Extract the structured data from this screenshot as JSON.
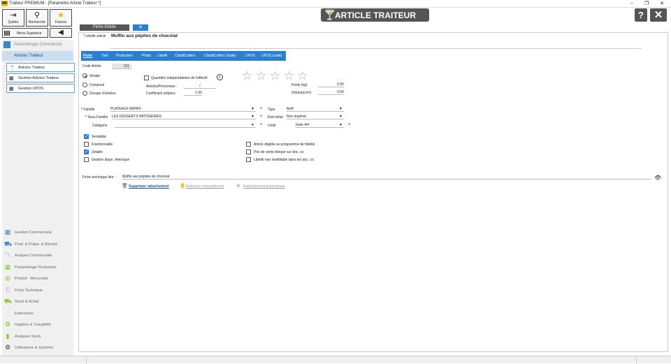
{
  "window": {
    "title": "Traiteur PREMIUM - [Paramètre Article Traiteur *]",
    "app_icon": "WD"
  },
  "toolbar": {
    "quit_label": "Quitter",
    "search_label": "Recherche",
    "favorites_label": "Favoris",
    "menu_superieur_label": "Menu Supérieur"
  },
  "sidebar": {
    "top_item": "Paramétrage Commercial",
    "active_section": "Articles Traiteur",
    "sub_items": [
      "Articles Traiteur",
      "Gestion Articles Traiteur",
      "Gestion UPOS"
    ],
    "bottom_items": [
      {
        "label": "Gestion Commerciale",
        "icon": "calculator-icon"
      },
      {
        "label": "Prod. & Prépa. & Récept.",
        "icon": "truck-icon"
      },
      {
        "label": "Analyse Commerciale",
        "icon": "chart-line-icon"
      },
      {
        "label": "Paramétrage Production",
        "icon": "grid-icon"
      },
      {
        "label": "Produit - Mercuriale",
        "icon": "plate-icon"
      },
      {
        "label": "Fiche Technique",
        "icon": "utensils-icon"
      },
      {
        "label": "Stock & Achat",
        "icon": "forklift-icon"
      },
      {
        "label": "Extensions",
        "icon": "dots-icon"
      },
      {
        "label": "Hygiène & Traçabilité",
        "icon": "hygiene-icon"
      },
      {
        "label": "Analyses Stock",
        "icon": "bars-icon"
      },
      {
        "label": "Utilisateurs & Système",
        "icon": "gears-icon"
      }
    ]
  },
  "header": {
    "title": "ARTICLE TRAITEUR",
    "help_label": "?",
    "close_label": "✕"
  },
  "fiche": {
    "tab_label": "Fiche Article",
    "libelle_label": "* Libellé article",
    "libelle_value": "Muffin aux pépites de chocolat"
  },
  "tabs": [
    "Fiche",
    "Tarif",
    "Production",
    "Photo",
    "Libellé",
    "Click&Collect",
    "Click&Collect (Suite)",
    "UPOS",
    "UPOS (suite)"
  ],
  "form": {
    "code_article_label": "Code Article",
    "code_article_value": "211",
    "type_options": [
      "Simple",
      "Composé",
      "Groupe d'articles"
    ],
    "type_selected": "Simple",
    "qte_indep_label": "Quantités indépendantes de l'effectif",
    "articles_personnes_label": "Articles/Personnes :",
    "articles_personnes_value": "/",
    "coef_label": "Coefficient art/pers",
    "coef_value": "1,00",
    "poids_label": "Poids (kg)",
    "poids_value": "0,00",
    "volume_label": "Volume(cm³)",
    "volume_value": "0,00",
    "famille_label": "* Famille",
    "famille_value": "PLATEAUX REPAS",
    "sous_famille_label": "* Sous Famille",
    "sous_famille_value": "LES DESSERTS PATISSERIES",
    "categorie_label": "Catégorie",
    "categorie_value": "",
    "type_label": "Type",
    "type_value": "Actif",
    "etat_label": "Etat initial",
    "etat_value": "Non imprimé",
    "unite_label": "Unité",
    "unite_value": "boite 4/4",
    "plus": "+"
  },
  "checkboxes_left": [
    {
      "label": "Vendable",
      "checked": true
    },
    {
      "label": "Fractionnable",
      "checked": false
    },
    {
      "label": "Jetable",
      "checked": true
    },
    {
      "label": "Gestion dispo. théorique",
      "checked": false
    }
  ],
  "checkboxes_right": [
    {
      "label": "Article éligible au programme de fidélité",
      "checked": false
    },
    {
      "label": "Prix de vente bloqué sur doc. co",
      "checked": false
    },
    {
      "label": "Libellé non modifiable dans les doc. co.",
      "checked": false
    }
  ],
  "fiche_technique": {
    "label": "Fiche technique liée :",
    "value": "Muffin aux pépites de chocolat",
    "delete_label": "Supprimer rattachement",
    "manual_label": "Rattacher manuellement",
    "auto_label": "Rattachement automatique"
  },
  "colors": {
    "accent": "#2b7fd3",
    "header": "#555555",
    "sidebar": "#f0f0f0"
  }
}
